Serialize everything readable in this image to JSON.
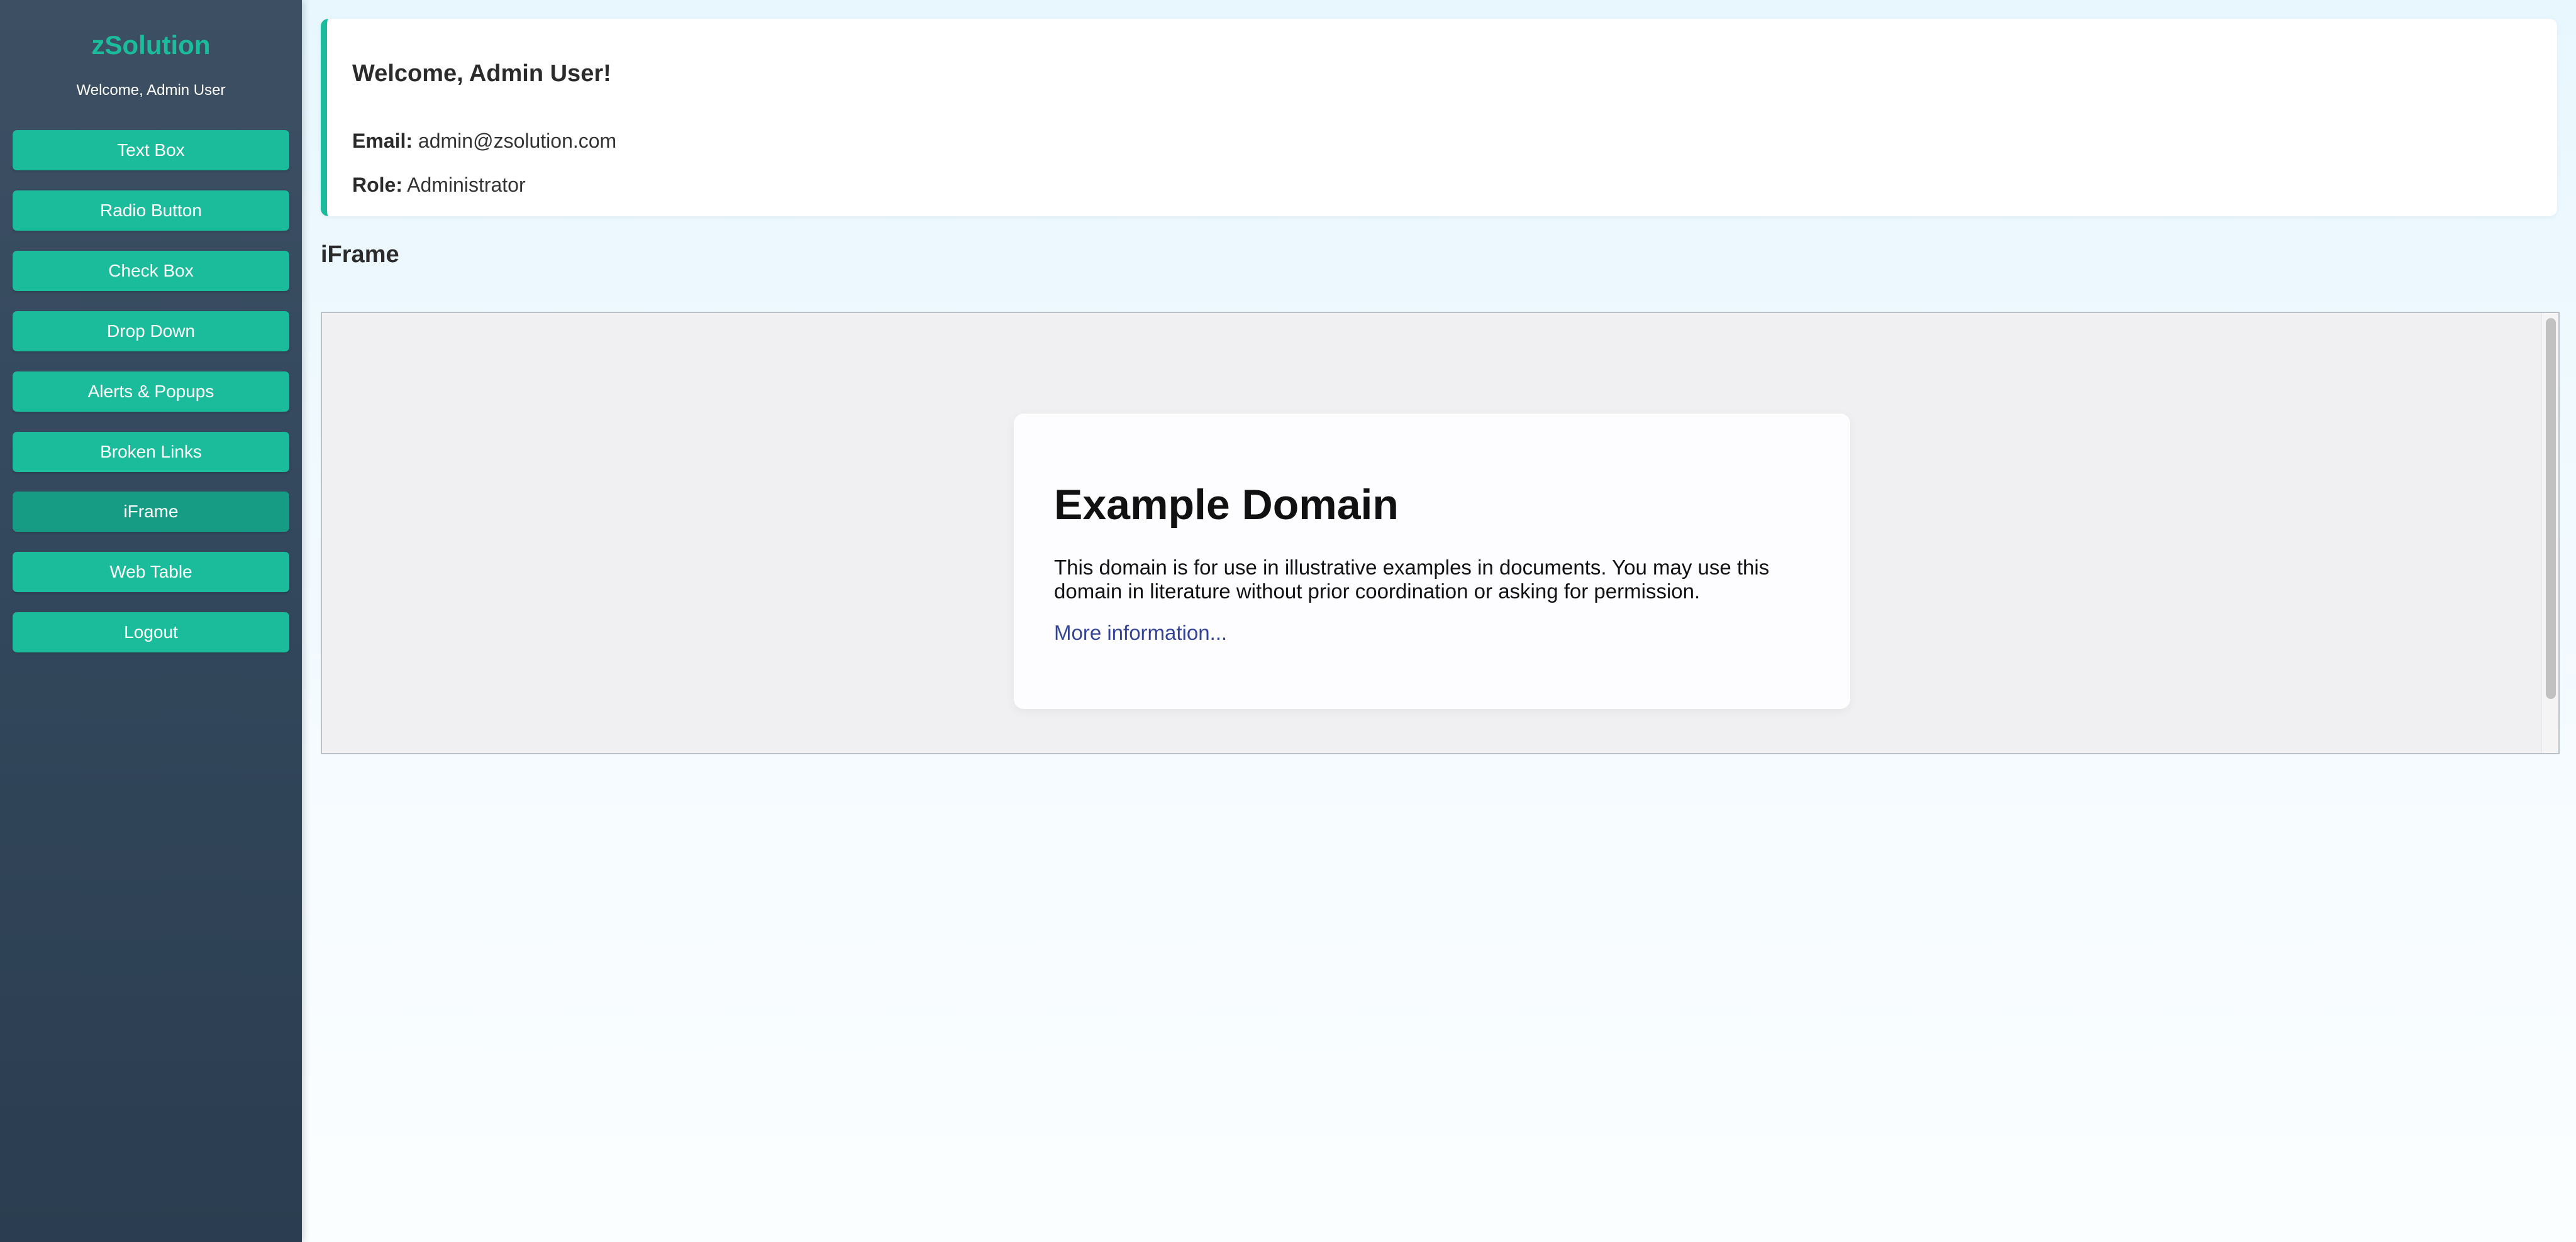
{
  "sidebar": {
    "brand": "zSolution",
    "welcome": "Welcome, Admin User",
    "items": [
      {
        "label": "Text Box"
      },
      {
        "label": "Radio Button"
      },
      {
        "label": "Check Box"
      },
      {
        "label": "Drop Down"
      },
      {
        "label": "Alerts & Popups"
      },
      {
        "label": "Broken Links"
      },
      {
        "label": "iFrame",
        "active": true
      },
      {
        "label": "Web Table"
      },
      {
        "label": "Logout"
      }
    ]
  },
  "user_card": {
    "title": "Welcome, Admin User!",
    "email_label": "Email:",
    "email": "admin@zsolution.com",
    "role_label": "Role:",
    "role": "Administrator"
  },
  "main": {
    "section_title": "iFrame"
  },
  "iframe": {
    "title": "Example Domain",
    "text": "This domain is for use in illustrative examples in documents. You may use this domain in literature without prior coordination or asking for permission.",
    "link": "More information..."
  },
  "colors": {
    "accent": "#1abc9c",
    "accent_active": "#169c84",
    "sidebar_bg": "#34495e",
    "link": "#334499"
  }
}
